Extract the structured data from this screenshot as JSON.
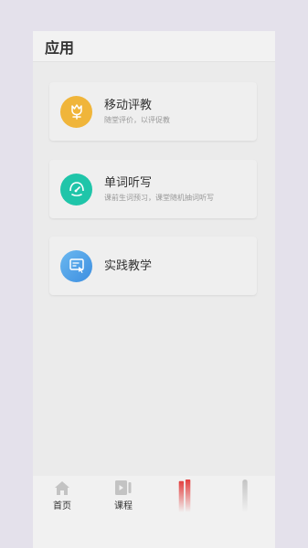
{
  "header": {
    "title": "应用"
  },
  "cards": [
    {
      "title": "移动评教",
      "subtitle": "随堂评价，以评促教",
      "icon": "tulip-icon",
      "color": "#f0b53a"
    },
    {
      "title": "单词听写",
      "subtitle": "课前生词预习，课堂随机抽词听写",
      "icon": "headset-icon",
      "color": "#1fc5a9"
    },
    {
      "title": "实践教学",
      "subtitle": "",
      "icon": "touch-screen-icon",
      "color": "#4aa3e8"
    }
  ],
  "tabbar": {
    "tabs": [
      {
        "label": "首页",
        "icon": "home-icon"
      },
      {
        "label": "课程",
        "icon": "video-icon"
      },
      {
        "label": "",
        "icon": "app-icon",
        "color": "#e2403f"
      },
      {
        "label": "",
        "icon": "profile-icon"
      }
    ]
  }
}
